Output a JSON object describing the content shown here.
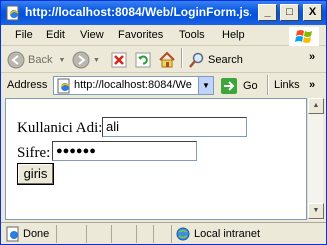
{
  "window": {
    "title": "http://localhost:8084/Web/LoginForm.js...",
    "min_glyph": "_",
    "max_glyph": "□",
    "close_glyph": "X"
  },
  "menu": {
    "items": [
      "File",
      "Edit",
      "View",
      "Favorites",
      "Tools",
      "Help"
    ]
  },
  "toolbar": {
    "back_label": "Back",
    "search_label": "Search",
    "more_glyph": "»"
  },
  "address": {
    "label": "Address",
    "url": "http://localhost:8084/We",
    "go_label": "Go",
    "links_label": "Links",
    "more_glyph": "»"
  },
  "form": {
    "username_label": "Kullanici Adi:",
    "username_value": "ali",
    "password_label": "Sifre:",
    "password_value": "●●●●●●",
    "submit_label": "giris"
  },
  "status": {
    "done_label": "Done",
    "zone_label": "Local intranet"
  }
}
